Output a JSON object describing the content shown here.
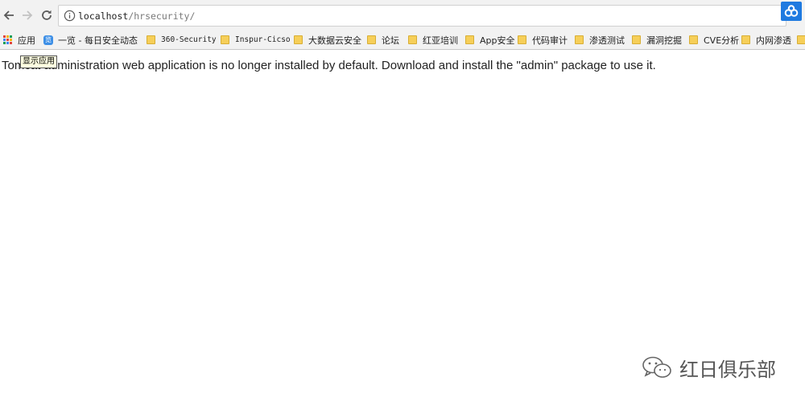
{
  "browser": {
    "url_host": "localhost",
    "url_path": "/hrsecurity/",
    "back_icon": "back-arrow-icon",
    "forward_icon": "forward-arrow-icon",
    "reload_icon": "reload-icon",
    "info_icon": "info-icon",
    "extension_icon": "extension-icon"
  },
  "bookmarks": {
    "apps_label": "应用",
    "items": [
      {
        "label": "一览 - 每日安全动态",
        "icon": "blue-favicon-icon"
      },
      {
        "label": "360-Security",
        "icon": "folder-icon"
      },
      {
        "label": "Inspur-Cicso",
        "icon": "folder-icon"
      },
      {
        "label": "大数据云安全",
        "icon": "folder-icon"
      },
      {
        "label": "论坛",
        "icon": "folder-icon"
      },
      {
        "label": "红亚培训",
        "icon": "folder-icon"
      },
      {
        "label": "App安全",
        "icon": "folder-icon"
      },
      {
        "label": "代码审计",
        "icon": "folder-icon"
      },
      {
        "label": "渗透测试",
        "icon": "folder-icon"
      },
      {
        "label": "漏洞挖掘",
        "icon": "folder-icon"
      },
      {
        "label": "CVE分析",
        "icon": "folder-icon"
      },
      {
        "label": "内网渗透",
        "icon": "folder-icon"
      }
    ]
  },
  "tooltip": {
    "text": "显示应用"
  },
  "main": {
    "message": "Tomcat administration web application is no longer installed by default. Download and install the \"admin\" package to use it."
  },
  "watermark": {
    "text": "红日俱乐部",
    "icon": "wechat-icon"
  },
  "colors": {
    "toolbar_bg": "#f2f2f2",
    "folder": "#f6cf59",
    "extension_bg": "#1f7ae0"
  }
}
